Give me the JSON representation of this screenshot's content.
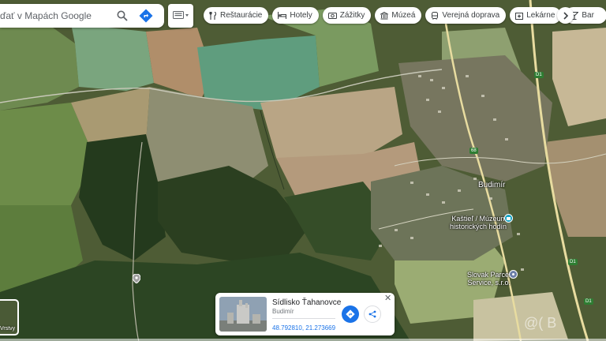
{
  "search": {
    "placeholder": "ďať v Mapách Google"
  },
  "chips": [
    {
      "label": "Reštaurácie",
      "icon": "restaurant-icon"
    },
    {
      "label": "Hotely",
      "icon": "hotel-icon"
    },
    {
      "label": "Zážitky",
      "icon": "camera-icon"
    },
    {
      "label": "Múzeá",
      "icon": "museum-icon"
    },
    {
      "label": "Verejná doprava",
      "icon": "transit-icon"
    },
    {
      "label": "Lekárne",
      "icon": "pharmacy-icon"
    },
    {
      "label": "Bar",
      "icon": "bar-icon"
    }
  ],
  "map_labels": {
    "village": "Budimír",
    "poi_kastiel_line1": "Kaštieľ / Múzeum",
    "poi_kastiel_line2": "historických hodín",
    "poi_slovak_line1": "Slovak Parcel",
    "poi_slovak_line2": "Service, s.r.o.",
    "road_shield_a": "D1",
    "road_shield_b": "D1",
    "road_shield_c": "D1",
    "road_shield_d": "68"
  },
  "infocard": {
    "title": "Sídlisko Ťahanovce",
    "subtitle": "Budimír",
    "coords": "48.792810, 21.273669"
  },
  "layers": {
    "label": "Vrstvy"
  },
  "watermark": "@( B"
}
